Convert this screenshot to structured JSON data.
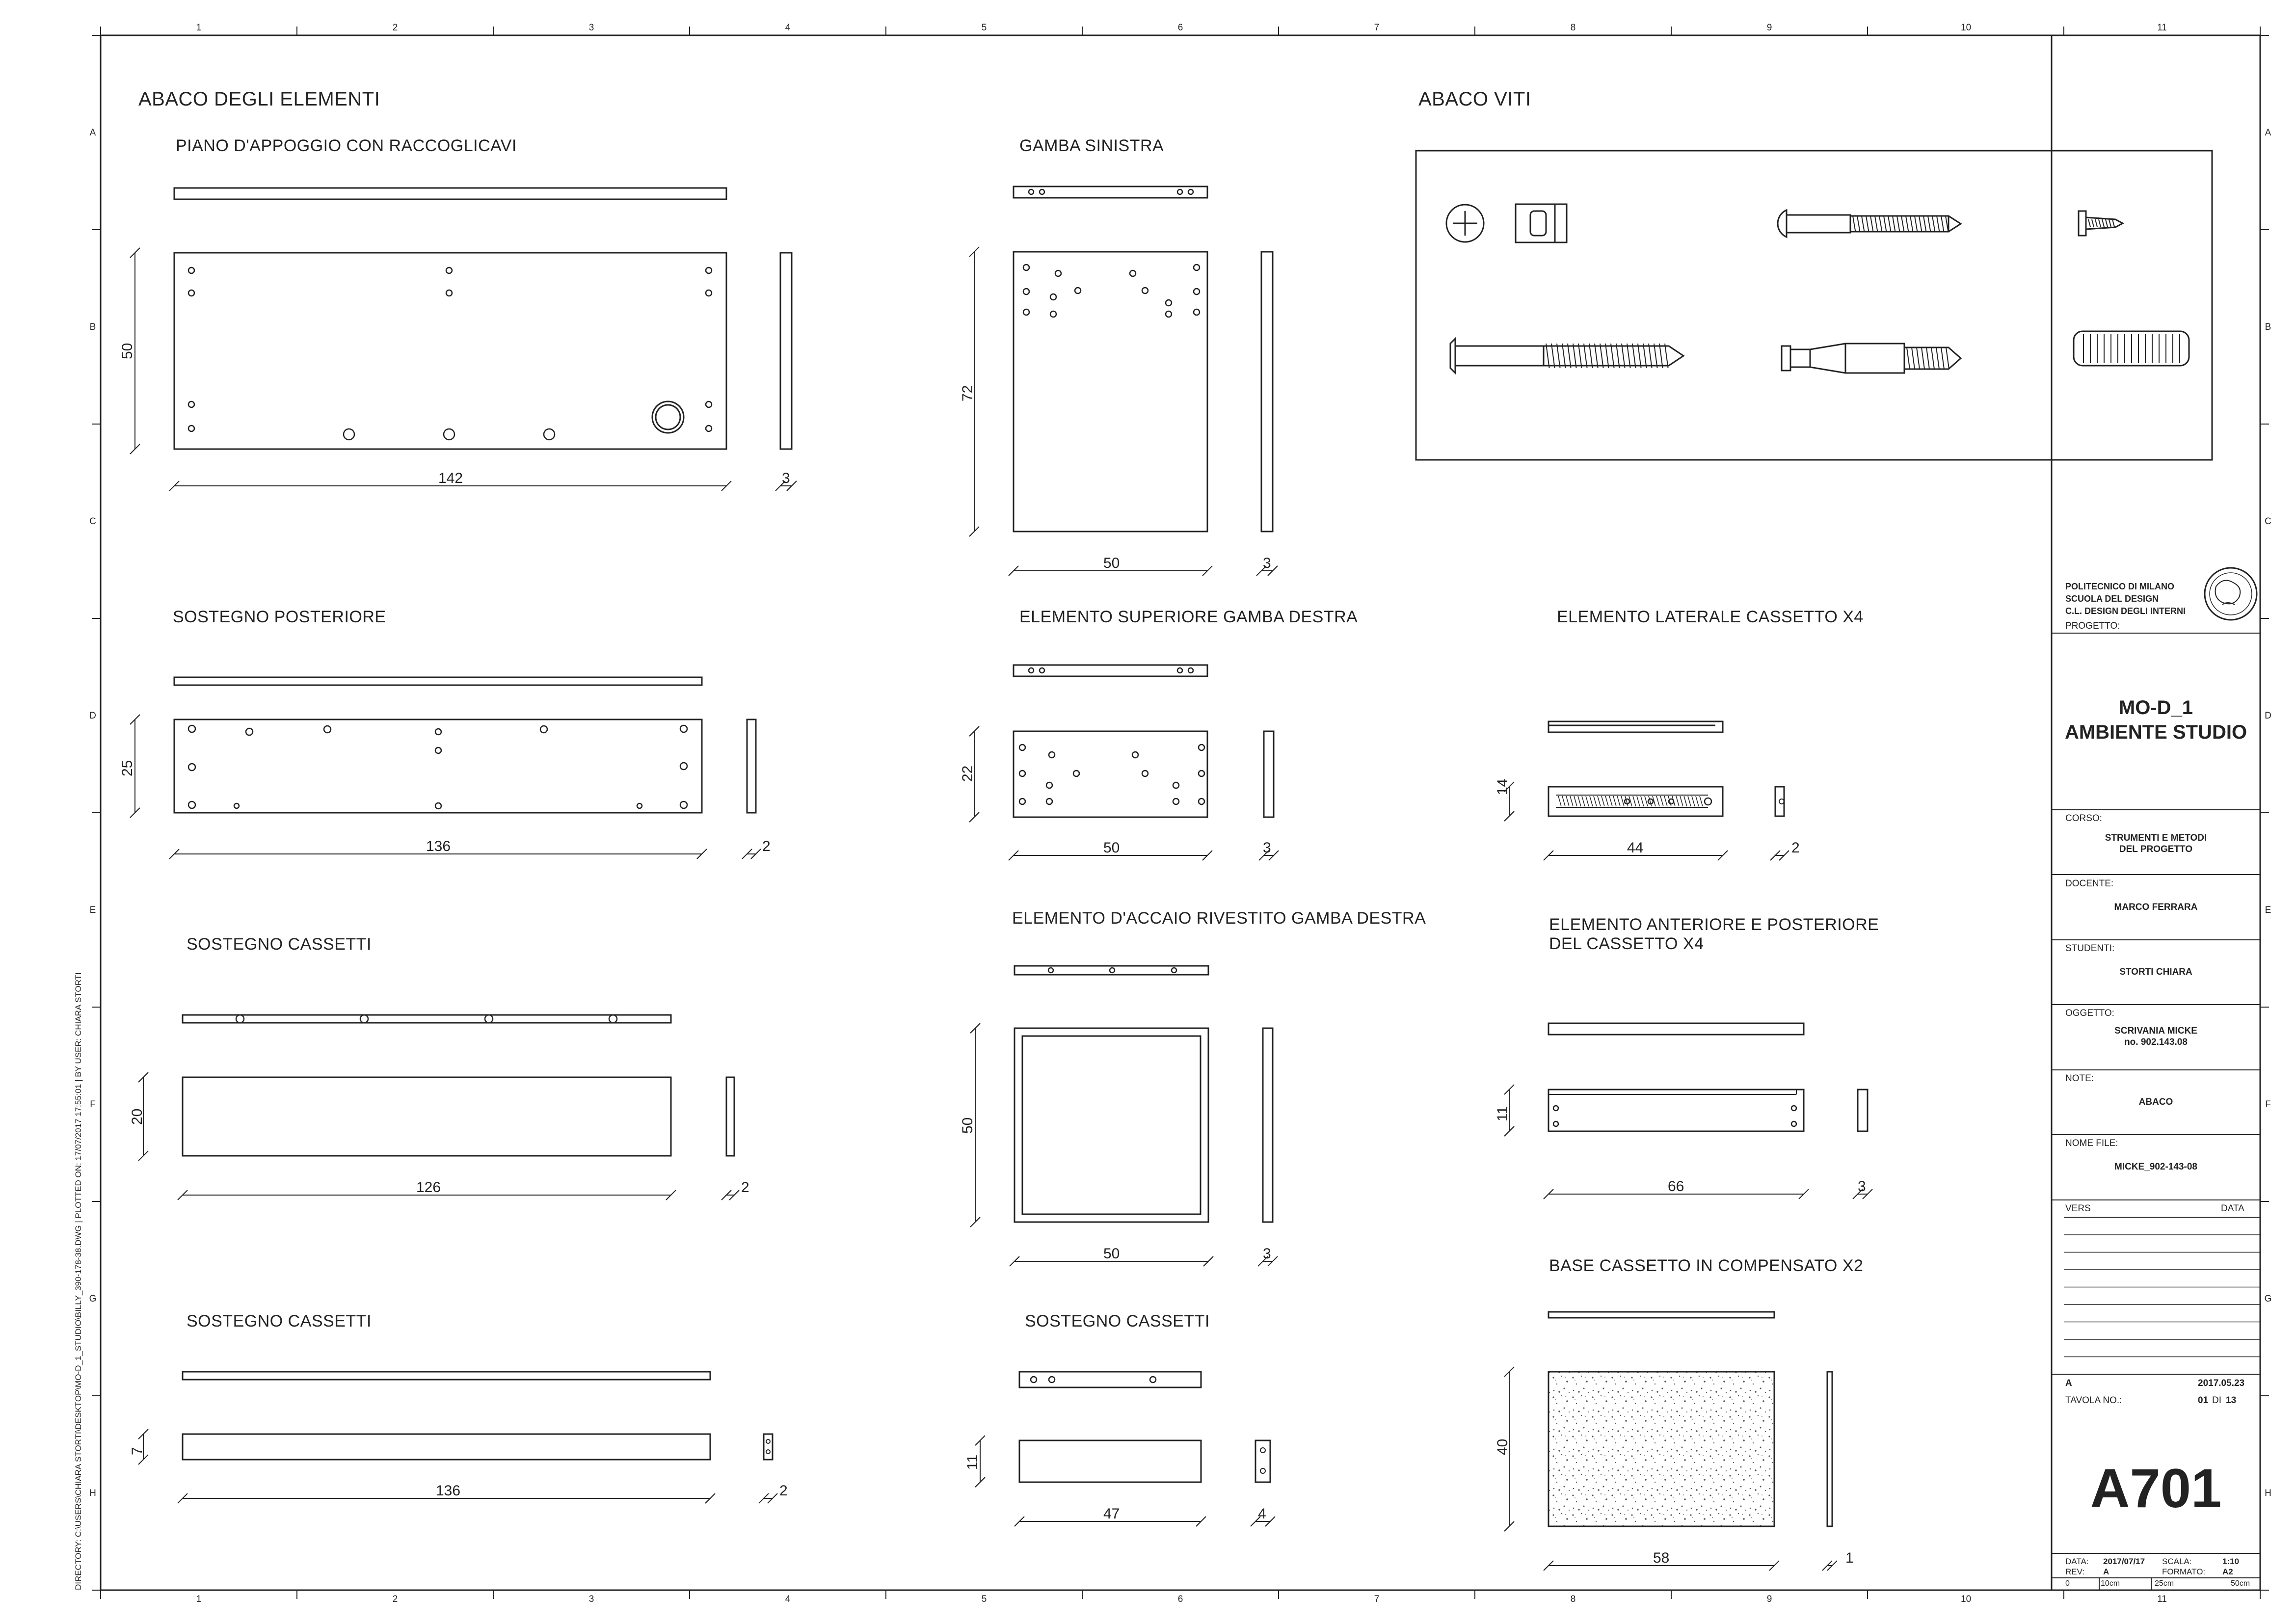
{
  "headings": {
    "abaco_elementi": "ABACO DEGLI ELEMENTI",
    "abaco_viti": "ABACO VITI"
  },
  "elements": {
    "piano": {
      "title": "PIANO D'APPOGGIO CON RACCOGLICAVI",
      "dim_h": "50",
      "dim_w": "142",
      "dim_t": "3"
    },
    "gamba_sx": {
      "title": "GAMBA SINISTRA",
      "dim_h": "72",
      "dim_w": "50",
      "dim_t": "3"
    },
    "sostegno_post": {
      "title": "SOSTEGNO POSTERIORE",
      "dim_h": "25",
      "dim_w": "136",
      "dim_t": "2"
    },
    "sup_gamba_dx": {
      "title": "ELEMENTO SUPERIORE GAMBA DESTRA",
      "dim_h": "22",
      "dim_w": "50",
      "dim_t": "3"
    },
    "laterale_cass": {
      "title": "ELEMENTO LATERALE CASSETTO X4",
      "dim_h": "14",
      "dim_w": "44",
      "dim_t": "2"
    },
    "sost_cass_1": {
      "title": "SOSTEGNO CASSETTI",
      "dim_h": "20",
      "dim_w": "126",
      "dim_t": "2"
    },
    "acciaio": {
      "title": "ELEMENTO D'ACCAIO RIVESTITO GAMBA DESTRA",
      "dim_h": "50",
      "dim_w": "50",
      "dim_t": "3"
    },
    "ant_post_cass": {
      "title_1": "ELEMENTO ANTERIORE E POSTERIORE",
      "title_2": "DEL CASSETTO X4",
      "dim_h": "11",
      "dim_w": "66",
      "dim_t": "3"
    },
    "sost_cass_2": {
      "title": "SOSTEGNO CASSETTI",
      "dim_h": "7",
      "dim_w": "136",
      "dim_t": "2"
    },
    "sost_cass_3": {
      "title": "SOSTEGNO CASSETTI",
      "dim_h": "11",
      "dim_w": "47",
      "dim_t": "4"
    },
    "base_cass": {
      "title": "BASE CASSETTO IN COMPENSATO X2",
      "dim_h": "40",
      "dim_w": "58",
      "dim_t": "1"
    }
  },
  "grid": {
    "columns": [
      "1",
      "2",
      "3",
      "4",
      "5",
      "6",
      "7",
      "8",
      "9",
      "10",
      "11"
    ],
    "rows": [
      "A",
      "B",
      "C",
      "D",
      "E",
      "F",
      "G",
      "H"
    ]
  },
  "side_path": "DIRECTORY: C:\\USERS\\CHIARA STORTI\\DESKTOP\\MO-D_1_STUDIO\\BILLY_390-178-38.DWG | PLOTTED ON: 17/07/2017 17:55:01 | BY USER: CHIARA STORTI",
  "title_block": {
    "school_1": "POLITECNICO DI MILANO",
    "school_2": "SCUOLA DEL DESIGN",
    "school_3": "C.L. DESIGN DEGLI INTERNI",
    "progetto_label": "PROGETTO:",
    "project_1": "MO-D_1",
    "project_2": "AMBIENTE STUDIO",
    "corso_label": "CORSO:",
    "corso_1": "STRUMENTI E METODI",
    "corso_2": "DEL PROGETTO",
    "docente_label": "DOCENTE:",
    "docente": "MARCO FERRARA",
    "studenti_label": "STUDENTI:",
    "studenti": "STORTI CHIARA",
    "oggetto_label": "OGGETTO:",
    "oggetto_1": "SCRIVANIA MICKE",
    "oggetto_2": "no. 902.143.08",
    "note_label": "NOTE:",
    "note": "ABACO",
    "nome_file_label": "NOME FILE:",
    "nome_file": "MICKE_902-143-08",
    "vers_label": "VERS",
    "data_label": "DATA",
    "rev_row_vers": "A",
    "rev_row_date": "2017.05.23",
    "tavola_label": "TAVOLA NO.:",
    "tavola_num": "01",
    "tavola_di": "DI",
    "tavola_tot": "13",
    "sheet_code": "A701",
    "data_k": "DATA:",
    "data_v": "2017/07/17",
    "scala_k": "SCALA:",
    "scala_v": "1:10",
    "rev_k": "REV:",
    "rev_v": "A",
    "formato_k": "FORMATO:",
    "formato_v": "A2",
    "scale_0": "0",
    "scale_10": "10cm",
    "scale_25": "25cm",
    "scale_50": "50cm"
  }
}
